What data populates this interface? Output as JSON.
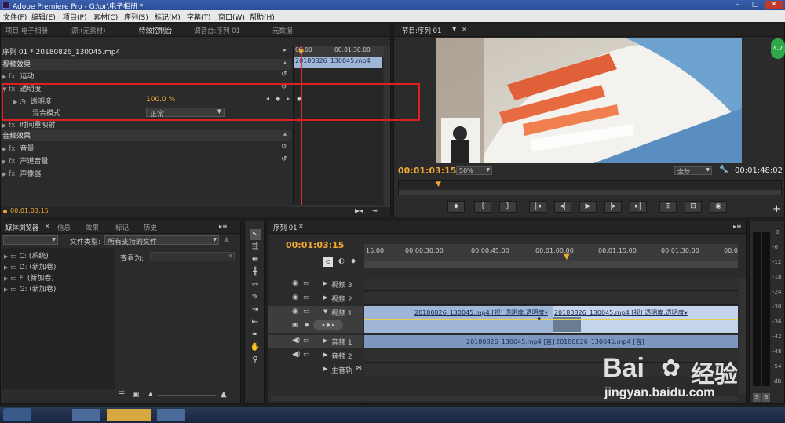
{
  "window": {
    "title": "Adobe Premiere Pro - G:\\pr\\电子相册 *",
    "minimize": "–",
    "maximize": "□",
    "close": "✕"
  },
  "menu": [
    "文件(F)",
    "编辑(E)",
    "项目(P)",
    "素材(C)",
    "序列(S)",
    "标记(M)",
    "字幕(T)",
    "窗口(W)",
    "帮助(H)"
  ],
  "left_panel": {
    "tabs": [
      "项目:电子相册",
      "源:(无素材)",
      "特效控制台",
      "调音台:序列 01",
      "元数据"
    ],
    "active_tab": 2,
    "header": "序列 01 * 20180826_130045.mp4",
    "video_effects": "视频效果",
    "effects": [
      {
        "name": "运动"
      },
      {
        "name": "透明度"
      },
      {
        "name": "透明度",
        "value": "100.0 %"
      },
      {
        "name": "混合模式",
        "value": "正常"
      },
      {
        "name": "时间重映射"
      }
    ],
    "audio_effects": "音频效果",
    "audio": [
      {
        "name": "音量"
      },
      {
        "name": "声道音量"
      },
      {
        "name": "声像器"
      }
    ],
    "timecode": "00:01:03:15",
    "mini_ruler": [
      "00:00",
      "00:01:30:00"
    ],
    "mini_clip": "20180826_130045.mp4",
    "fx": "fx"
  },
  "program": {
    "tab": "节目:序列 01",
    "timecode": "00:01:03:15",
    "zoom": "50%",
    "quality": "全分...",
    "duration": "00:01:48:02",
    "badge": "4.7",
    "buttons": [
      "⬥",
      "{",
      "}",
      "|◂",
      "◂|",
      "▶",
      "|▸",
      "▸|",
      "⊞",
      "⊟",
      "◉"
    ],
    "plus": "+"
  },
  "media_browser": {
    "tabs": [
      "媒体浏览器",
      "信息",
      "效果",
      "标记",
      "历史"
    ],
    "file_type_label": "文件类型:",
    "file_type_value": "所有支持的文件",
    "view_as_label": "查看为:",
    "drives": [
      "C: (系统)",
      "D: (新加卷)",
      "F: (新加卷)",
      "G: (新加卷)"
    ]
  },
  "timeline": {
    "tab": "序列 01",
    "timecode": "00:01:03:15",
    "ruler": [
      "15:00",
      "00:00:30:00",
      "00:00:45:00",
      "00:01:00:00",
      "00:01:15:00",
      "00:01:30:00",
      "00:0"
    ],
    "tracks": [
      {
        "name": "视频 3"
      },
      {
        "name": "视频 2"
      },
      {
        "name": "视频 1"
      },
      {
        "name": "音频 1"
      },
      {
        "name": "音频 2"
      },
      {
        "name": "主音轨"
      }
    ],
    "video_clip_1": "20180826_130045.mp4 [视] 透明度:透明度▾",
    "video_clip_2": "20180826_130045.mp4 [视] 透明度:透明度▾",
    "audio_clip_1": "20180826_130045.mp4 [音]",
    "audio_clip_2": "20180826_130045.mp4 [音]"
  },
  "meter": {
    "scale": [
      "0",
      "-6",
      "-12",
      "-18",
      "-24",
      "-30",
      "-36",
      "-42",
      "-48",
      "-54",
      "dB"
    ],
    "solo": [
      "S",
      "S"
    ]
  },
  "watermark": {
    "brand": "Bai",
    "brand2": "经验",
    "url": "jingyan.baidu.com"
  },
  "colors": {
    "accent": "#f0a830",
    "playhead": "#d83030",
    "highlight_box": "#e02020",
    "clip_blue": "#9fb6d6"
  }
}
